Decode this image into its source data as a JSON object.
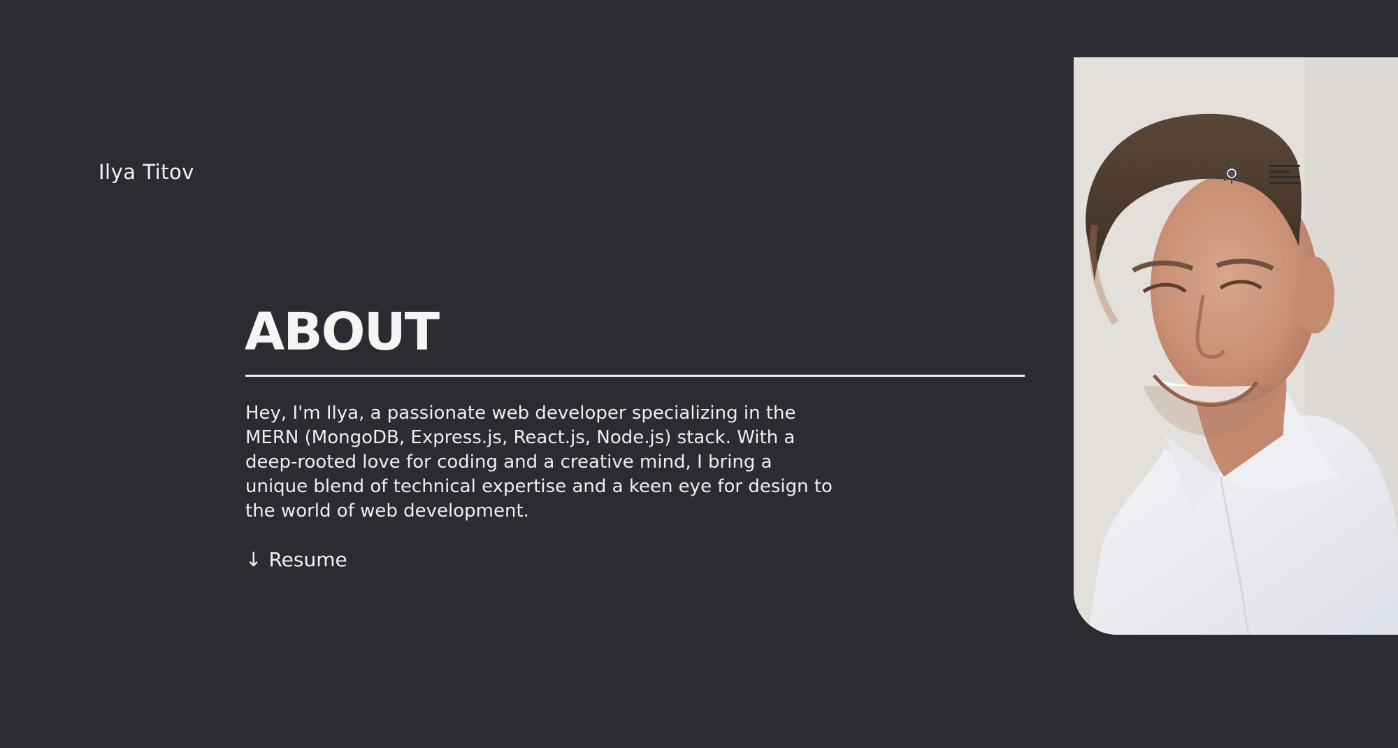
{
  "header": {
    "logo_text": "Ilya Titov",
    "theme_toggle_icon": "sun-icon",
    "menu_icon": "hamburger-menu-icon"
  },
  "about": {
    "title": "ABOUT",
    "bio": "Hey, I'm Ilya, a passionate web developer specializing in the MERN (MongoDB, Express.js, React.js, Node.js) stack. With a deep-rooted love for coding and a creative mind, I bring a unique blend of technical expertise and a keen eye for design to the world of web development.",
    "resume_arrow": "↓",
    "resume_label": "Resume"
  },
  "photo": {
    "alt": "Portrait photo"
  },
  "colors": {
    "background": "#2b2c31",
    "text": "#f2f2f2",
    "photo_bg": "#e2dfdb"
  }
}
